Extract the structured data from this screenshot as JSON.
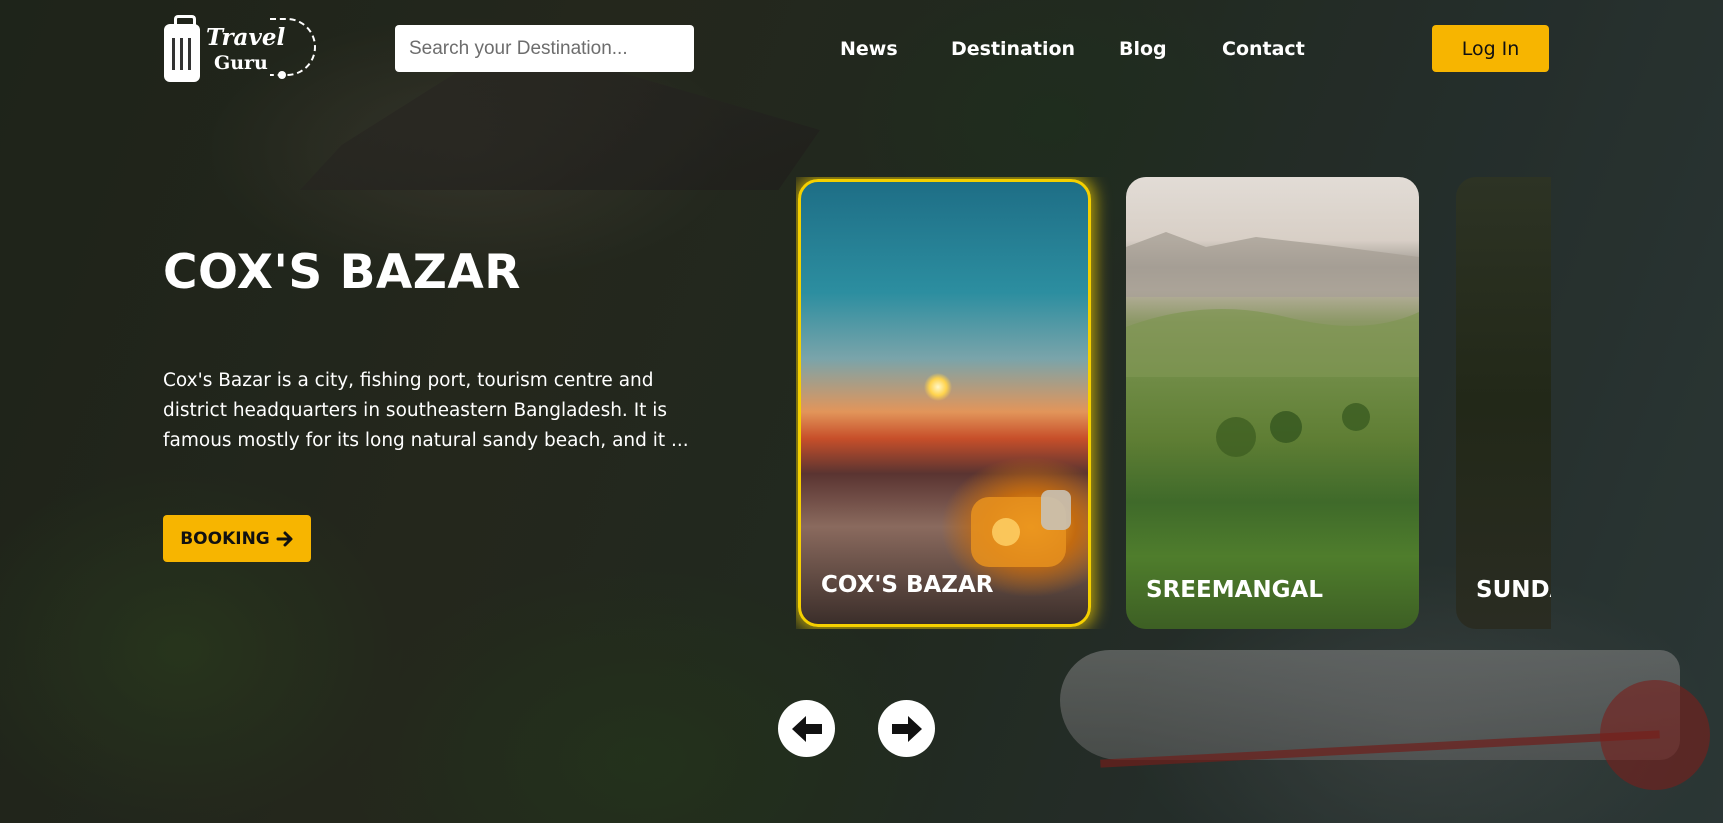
{
  "brand": {
    "line1": "Travel",
    "line2": "Guru"
  },
  "search": {
    "placeholder": "Search your Destination..."
  },
  "nav": {
    "items": [
      "News",
      "Destination",
      "Blog",
      "Contact"
    ]
  },
  "login": {
    "label": "Log In"
  },
  "hero": {
    "title": "COX'S BAZAR",
    "description": "Cox's Bazar is a city, fishing port, tourism centre and district headquarters in southeastern Bangladesh. It is famous mostly for its long natural sandy beach, and it ...",
    "booking_label": "BOOKING"
  },
  "cards": [
    {
      "label": "COX'S BAZAR",
      "active": true
    },
    {
      "label": "SREEMANGAL",
      "active": false
    },
    {
      "label": "SUNDARBANS",
      "active": false
    }
  ],
  "icons": {
    "booking": "arrow-right-icon",
    "prev": "arrow-left-icon",
    "next": "arrow-right-icon"
  },
  "colors": {
    "accent": "#F7B500",
    "card_highlight": "#F5D000"
  }
}
